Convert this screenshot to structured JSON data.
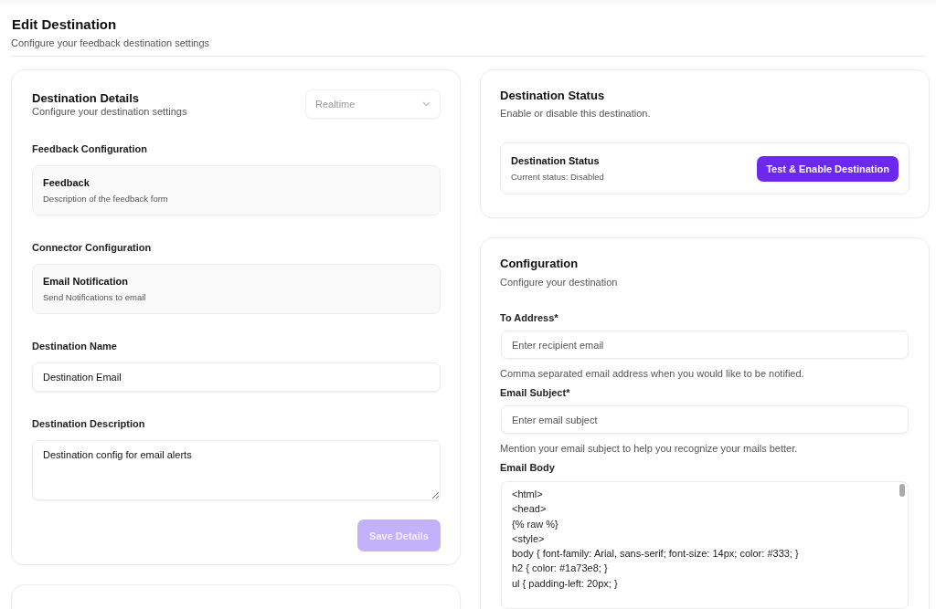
{
  "header": {
    "title": "Edit Destination",
    "subtitle": "Configure your feedback destination settings"
  },
  "details_card": {
    "title": "Destination Details",
    "subtitle": "Configure your destination settings",
    "mode_dropdown": {
      "value": "Realtime",
      "disabled": true
    },
    "sections": [
      {
        "label": "Feedback Configuration",
        "tile": {
          "title": "Feedback",
          "description": "Description of the feedback form"
        }
      },
      {
        "label": "Connector Configuration",
        "tile": {
          "title": "Email Notification",
          "description": "Send Notifications to email"
        }
      }
    ],
    "name_field": {
      "label": "Destination Name",
      "value": "Destination Email"
    },
    "description_field": {
      "label": "Destination Description",
      "value": "Destination config for email alerts"
    },
    "save_button": {
      "label": "Save Details",
      "disabled": true
    }
  },
  "status_card": {
    "title": "Destination Status",
    "subtitle": "Enable or disable this destination.",
    "status_box": {
      "title": "Destination Status",
      "status": "Current status: Disabled"
    },
    "enable_button": {
      "label": "Test & Enable Destination",
      "disabled": false
    }
  },
  "configuration_card": {
    "title": "Configuration",
    "subtitle": "Configure your destination",
    "fields": [
      {
        "label": "To Address*",
        "placeholder": "Enter recipient email",
        "help": "Comma separated email address when you would like to be notified."
      },
      {
        "label": "Email Subject*",
        "placeholder": "Enter email subject",
        "help": "Mention your email subject to help you recognize your mails better."
      }
    ],
    "body_field": {
      "label": "Email Body",
      "lines": [
        "<html>",
        "<head>",
        "{% raw %}",
        "<style>",
        "body { font-family: Arial, sans-serif; font-size: 14px; color: #333; }",
        "h2 { color: #1a73e8; }",
        "ul { padding-left: 20px; }"
      ]
    }
  }
}
